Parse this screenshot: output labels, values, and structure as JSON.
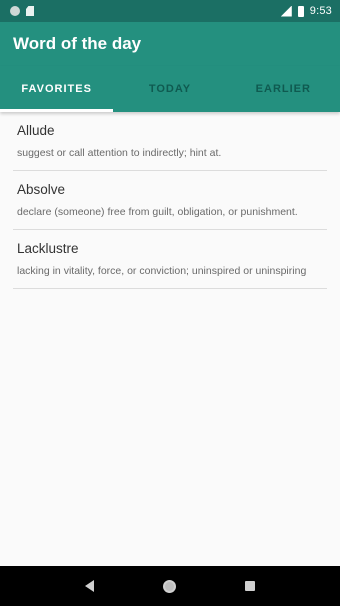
{
  "status_bar": {
    "time": "9:53",
    "icons": [
      "notification-dot-icon",
      "sd-card-icon",
      "signal-icon",
      "battery-icon"
    ]
  },
  "app_bar": {
    "title": "Word of the day"
  },
  "tabs": [
    {
      "label": "FAVORITES",
      "active": true
    },
    {
      "label": "TODAY",
      "active": false
    },
    {
      "label": "EARLIER",
      "active": false
    }
  ],
  "words": [
    {
      "word": "Allude",
      "definition": "suggest or call attention to indirectly; hint at."
    },
    {
      "word": "Absolve",
      "definition": "declare (someone) free from guilt, obligation, or punishment."
    },
    {
      "word": "Lacklustre",
      "definition": "lacking in vitality, force, or conviction; uninspired or uninspiring"
    }
  ],
  "nav_bar": {
    "icons": [
      "back-icon",
      "home-icon",
      "recents-icon"
    ]
  },
  "colors": {
    "primary": "#24907f",
    "primary_dark": "#1b6f64",
    "tab_inactive": "#0f5a50"
  }
}
